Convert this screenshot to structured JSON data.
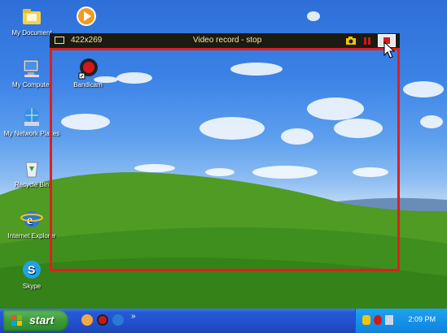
{
  "desktop_icons": {
    "my_documents": "My Document",
    "my_computer": "My Computer",
    "my_network": "My Network Places",
    "recycle_bin": "Recycle Bin",
    "internet_explorer": "Internet Explorer",
    "skype": "Skype",
    "bandicam": "Bandicam"
  },
  "bandicam": {
    "size_text": "422x269",
    "title": "Video record - stop",
    "frame_color": "#e01e1e"
  },
  "taskbar": {
    "start_label": "start",
    "clock": "2:09 PM",
    "quicklaunch_arrow": "»"
  },
  "colors": {
    "taskbar_blue": "#2350cc",
    "start_green": "#3c9a3a",
    "tray_blue": "#0f82de",
    "toolbar_text": "#f4e9a0"
  }
}
